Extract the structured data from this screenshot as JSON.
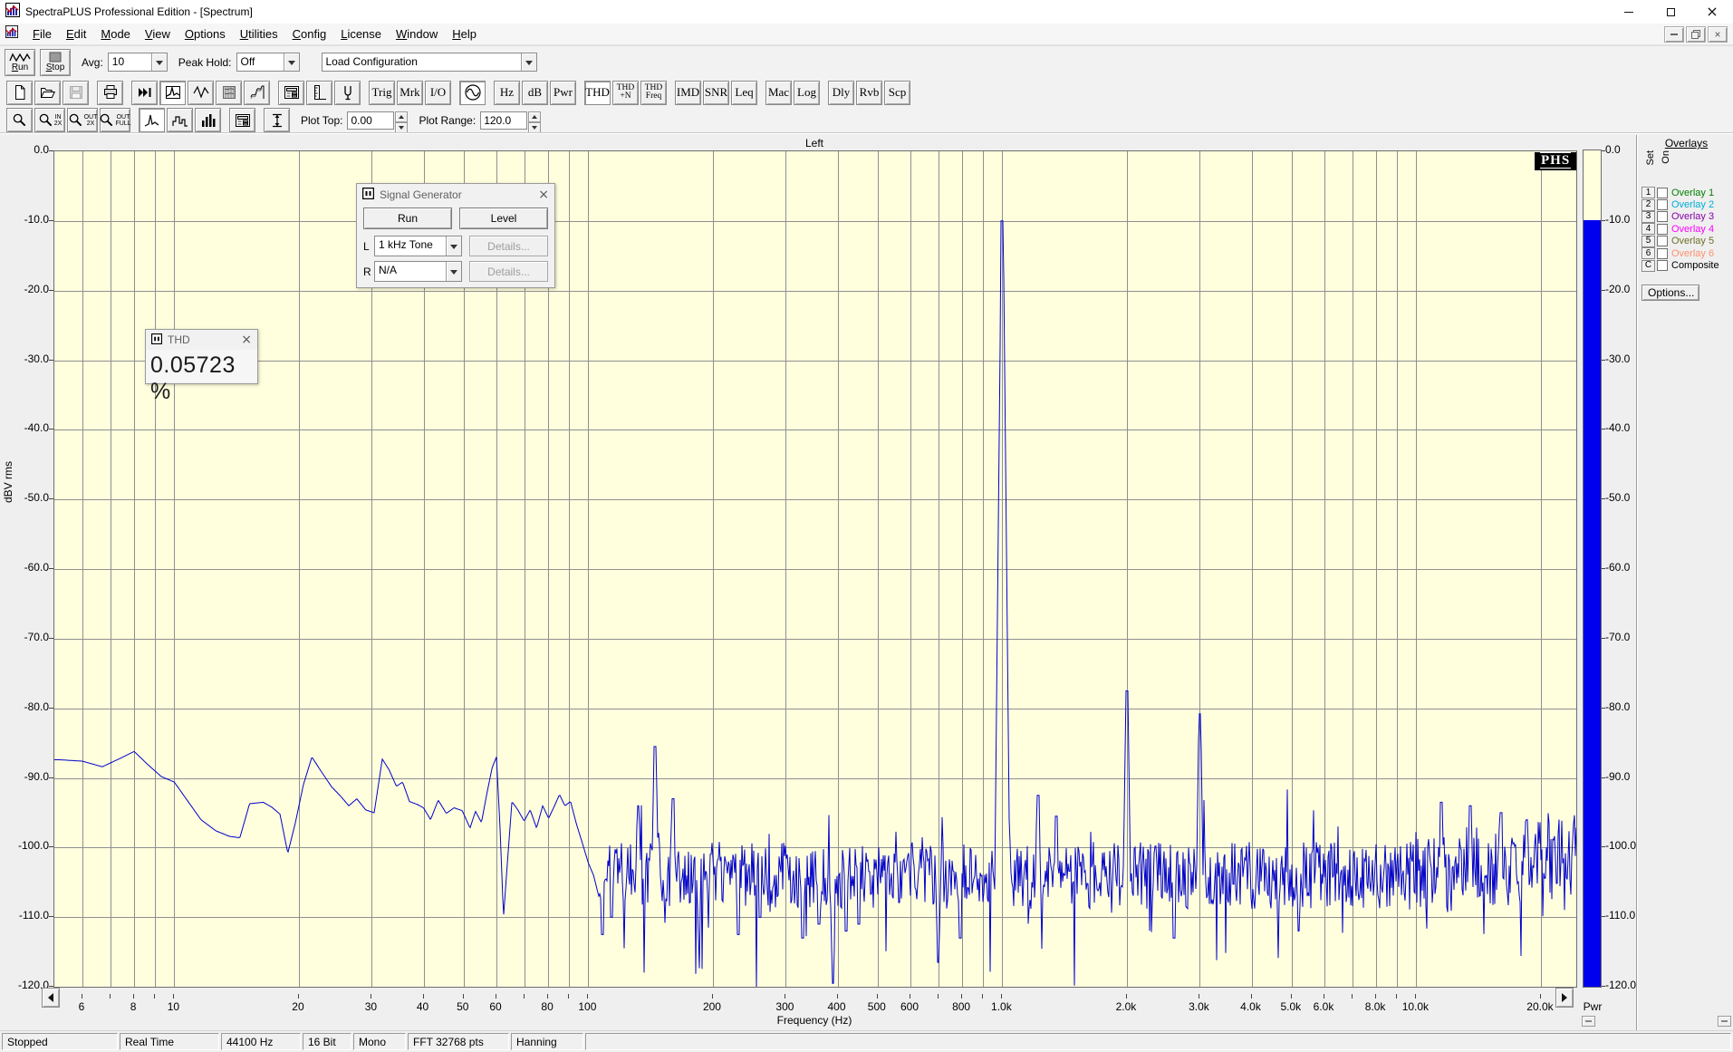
{
  "window": {
    "title": "SpectraPLUS Professional Edition - [Spectrum]"
  },
  "menu": {
    "items": [
      "File",
      "Edit",
      "Mode",
      "View",
      "Options",
      "Utilities",
      "Config",
      "License",
      "Window",
      "Help"
    ]
  },
  "transport": {
    "run_label": "Run",
    "stop_label": "Stop",
    "avg_label": "Avg:",
    "avg_value": "10",
    "peak_hold_label": "Peak Hold:",
    "peak_hold_value": "Off",
    "load_config_value": "Load Configuration"
  },
  "toolbar_main": {
    "buttons": [
      {
        "name": "new-file",
        "icon": "new-file-icon"
      },
      {
        "name": "open-file",
        "icon": "open-file-icon"
      },
      {
        "name": "save-file",
        "icon": "save-icon",
        "disabled": true
      },
      {
        "name": "print",
        "icon": "print-icon",
        "group": true
      },
      {
        "name": "restart-averaging",
        "icon": "fast-forward-icon",
        "group": true
      },
      {
        "name": "spectrum-view",
        "icon": "spectrum-view-icon",
        "pressed": true
      },
      {
        "name": "time-series-view",
        "icon": "waveform-view-icon"
      },
      {
        "name": "spectrogram-view",
        "icon": "spectrogram-view-icon"
      },
      {
        "name": "surface-view",
        "icon": "surface-view-icon"
      },
      {
        "name": "display-settings",
        "icon": "display-settings-icon",
        "group": true
      },
      {
        "name": "scaling",
        "icon": "scale-ruler-icon"
      },
      {
        "name": "calibration",
        "icon": "calibration-icon"
      },
      {
        "name": "triggering",
        "label": "Trig",
        "group": true
      },
      {
        "name": "markers",
        "label": "Mrk"
      },
      {
        "name": "io-device",
        "label": "I/O"
      },
      {
        "name": "signal-generator",
        "icon": "signal-generator-icon",
        "pressed": true,
        "group": true
      },
      {
        "name": "frequency-units",
        "label": "Hz",
        "group": true
      },
      {
        "name": "amplitude-units",
        "label": "dB"
      },
      {
        "name": "power-units",
        "label": "Pwr"
      },
      {
        "name": "thd",
        "label": "THD",
        "pressed": true,
        "group": true
      },
      {
        "name": "thd-plus-n",
        "label": "THD\n+N"
      },
      {
        "name": "thd-freq",
        "label": "THD\nFreq"
      },
      {
        "name": "imd",
        "label": "IMD",
        "group": true
      },
      {
        "name": "snr",
        "label": "SNR"
      },
      {
        "name": "leq",
        "label": "Leq"
      },
      {
        "name": "macros",
        "label": "Mac",
        "group": true
      },
      {
        "name": "logging",
        "label": "Log"
      },
      {
        "name": "delay-finder",
        "label": "Dly",
        "group": true
      },
      {
        "name": "reverb",
        "label": "Rvb"
      },
      {
        "name": "scope",
        "label": "Scp"
      }
    ]
  },
  "toolbar_zoom": {
    "buttons": [
      {
        "name": "zoom",
        "icon": "zoom-icon"
      },
      {
        "name": "zoom-in-2x",
        "icon": "zoom-icon",
        "text": "IN\n2X"
      },
      {
        "name": "zoom-out-2x",
        "icon": "zoom-icon",
        "text": "OUT\n2X"
      },
      {
        "name": "zoom-out-full",
        "icon": "zoom-icon",
        "text": "OUT\nFULL"
      },
      {
        "name": "line-plot",
        "icon": "line-plot-icon",
        "pressed": true,
        "group": true
      },
      {
        "name": "step-plot",
        "icon": "step-plot-icon"
      },
      {
        "name": "bar-plot",
        "icon": "bar-plot-icon"
      },
      {
        "name": "display-options",
        "icon": "display-settings-icon",
        "group": true
      },
      {
        "name": "amplitude-scale",
        "icon": "amplitude-scale-icon",
        "group": true
      }
    ]
  },
  "plot_controls": {
    "plot_top_label": "Plot Top:",
    "plot_top_value": "0.00",
    "plot_range_label": "Plot Range:",
    "plot_range_value": "120.0"
  },
  "plot": {
    "channel_title": "Left",
    "ylabel": "dBV rms",
    "xlabel": "Frequency (Hz)",
    "logo": "PHS",
    "pwr_label": "Pwr"
  },
  "signal_generator": {
    "title": "Signal Generator",
    "run_label": "Run",
    "level_label": "Level",
    "l_label": "L",
    "l_value": "1 kHz Tone",
    "r_label": "R",
    "r_value": "N/A",
    "details_label": "Details..."
  },
  "thd_window": {
    "title": "THD",
    "value": "0.05723 %"
  },
  "overlays": {
    "header": "Overlays",
    "set_label": "Set",
    "on_label": "On",
    "options_label": "Options...",
    "rows": [
      {
        "btn": "1",
        "label": "Overlay 1",
        "color": "#008000"
      },
      {
        "btn": "2",
        "label": "Overlay 2",
        "color": "#00aed6"
      },
      {
        "btn": "3",
        "label": "Overlay 3",
        "color": "#8800aa"
      },
      {
        "btn": "4",
        "label": "Overlay 4",
        "color": "#ff00ff"
      },
      {
        "btn": "5",
        "label": "Overlay 5",
        "color": "#6e6e28"
      },
      {
        "btn": "6",
        "label": "Overlay 6",
        "color": "#ff9070"
      },
      {
        "btn": "C",
        "label": "Composite",
        "color": "#000000"
      }
    ]
  },
  "status_bar": [
    "Stopped",
    "Real Time",
    "44100 Hz",
    "16 Bit",
    "Mono",
    "FFT 32768 pts",
    "Hanning",
    ""
  ],
  "chart_data": {
    "type": "line",
    "title": "Left",
    "xlabel": "Frequency (Hz)",
    "ylabel": "dBV rms",
    "x_scale": "log",
    "xlim": [
      5.3,
      24300
    ],
    "ylim": [
      -120,
      0
    ],
    "grid": true,
    "trace_color": "#0000cc",
    "plot_bg": "#ffffde",
    "grid_color": "#8f8f8f",
    "y_ticks": [
      0,
      -10,
      -20,
      -30,
      -40,
      -50,
      -60,
      -70,
      -80,
      -90,
      -100,
      -110,
      -120
    ],
    "y_tick_labels": [
      "0.0",
      "-10.0",
      "-20.0",
      "-30.0",
      "-40.0",
      "-50.0",
      "-60.0",
      "-70.0",
      "-80.0",
      "-90.0",
      "-100.0",
      "-110.0",
      "-120.0"
    ],
    "x_tick_values": [
      6,
      8,
      10,
      20,
      30,
      40,
      50,
      60,
      80,
      100,
      200,
      300,
      400,
      500,
      600,
      800,
      1000,
      2000,
      3000,
      4000,
      5000,
      6000,
      8000,
      10000,
      20000
    ],
    "x_tick_labels": [
      "6",
      "8",
      "10",
      "20",
      "30",
      "40",
      "50",
      "60",
      "80",
      "100",
      "200",
      "300",
      "400",
      "500",
      "600",
      "800",
      "1.0k",
      "2.0k",
      "3.0k",
      "4.0k",
      "5.0k",
      "6.0k",
      "8.0k",
      "10.0k",
      "20.0k"
    ],
    "envelope_db_by_hz": [
      [
        5.3,
        -87.4
      ],
      [
        6.0,
        -87.6
      ],
      [
        6.7,
        -88.4
      ],
      [
        7.4,
        -87.2
      ],
      [
        8.0,
        -86.2
      ],
      [
        8.6,
        -88.0
      ],
      [
        9.3,
        -89.8
      ],
      [
        10.0,
        -90.6
      ],
      [
        10.8,
        -93.4
      ],
      [
        11.6,
        -96.0
      ],
      [
        12.6,
        -97.6
      ],
      [
        13.6,
        -98.4
      ],
      [
        14.4,
        -98.6
      ],
      [
        15.2,
        -93.7
      ],
      [
        16.4,
        -93.5
      ],
      [
        17.2,
        -94.2
      ],
      [
        18.0,
        -95.2
      ],
      [
        18.8,
        -100.8
      ],
      [
        19.6,
        -96.5
      ],
      [
        20.5,
        -91.0
      ],
      [
        21.5,
        -87.0
      ],
      [
        22.6,
        -89.0
      ],
      [
        24.0,
        -91.3
      ],
      [
        25.2,
        -92.6
      ],
      [
        26.4,
        -94.0
      ],
      [
        27.6,
        -93.0
      ],
      [
        29.0,
        -94.6
      ],
      [
        30.4,
        -95.0
      ],
      [
        31.8,
        -87.3
      ],
      [
        33.0,
        -88.8
      ],
      [
        34.4,
        -91.2
      ],
      [
        35.6,
        -90.6
      ],
      [
        37.0,
        -93.4
      ],
      [
        38.6,
        -93.8
      ],
      [
        40.0,
        -94.3
      ],
      [
        41.6,
        -96.0
      ],
      [
        43.4,
        -93.2
      ],
      [
        45.4,
        -95.1
      ],
      [
        47.4,
        -94.3
      ],
      [
        49.6,
        -94.7
      ],
      [
        51.8,
        -97.2
      ],
      [
        53.4,
        -94.8
      ],
      [
        55.2,
        -96.4
      ],
      [
        57.0,
        -92.0
      ],
      [
        58.6,
        -88.5
      ],
      [
        60.0,
        -87.0
      ],
      [
        61.2,
        -97.0
      ],
      [
        62.4,
        -110.0
      ],
      [
        63.8,
        -102.0
      ],
      [
        65.4,
        -93.4
      ],
      [
        67.6,
        -94.6
      ],
      [
        70.0,
        -96.2
      ],
      [
        72.4,
        -94.6
      ],
      [
        75.0,
        -97.2
      ],
      [
        77.6,
        -94.0
      ],
      [
        80.2,
        -95.8
      ],
      [
        82.6,
        -94.2
      ],
      [
        85.2,
        -92.4
      ],
      [
        87.8,
        -94.0
      ],
      [
        90.6,
        -93.4
      ],
      [
        93.6,
        -96.6
      ],
      [
        96.8,
        -99.4
      ],
      [
        100.0,
        -102.2
      ],
      [
        103.0,
        -104.0
      ],
      [
        106.0,
        -107.0
      ],
      [
        110.0,
        -104.5
      ]
    ],
    "spikes": [
      [
        132,
        -94,
        6
      ],
      [
        145,
        -85.5,
        7
      ],
      [
        160,
        -93,
        6
      ],
      [
        1000,
        -10,
        13
      ],
      [
        1220,
        -92.5,
        7
      ],
      [
        1350,
        -95.5,
        7
      ],
      [
        2000,
        -77.5,
        9
      ],
      [
        3000,
        -80.8,
        9
      ],
      [
        11500,
        -93.5,
        7
      ],
      [
        13500,
        -94,
        7
      ],
      [
        16000,
        -95,
        7
      ],
      [
        18500,
        -96,
        7
      ]
    ],
    "dips": [
      [
        108,
        -112.5,
        8
      ],
      [
        114,
        -110,
        8
      ],
      [
        122,
        -107.5,
        8
      ],
      [
        185,
        -113,
        9
      ],
      [
        230,
        -112.5,
        9
      ],
      [
        260,
        -110,
        9
      ],
      [
        330,
        -113,
        9
      ],
      [
        360,
        -111,
        9
      ],
      [
        390,
        -119.5,
        10
      ],
      [
        420,
        -112,
        9
      ],
      [
        450,
        -111,
        9
      ],
      [
        700,
        -116.5,
        10
      ],
      [
        790,
        -113,
        9
      ],
      [
        2600,
        -113,
        9
      ],
      [
        5200,
        -112,
        9
      ]
    ],
    "noise": {
      "start_hz": 110,
      "base_db": -104,
      "base_db_hf": -101.5,
      "hf_start_hz": 9000,
      "amp_db": 4.8,
      "amp_db_hf": 6.0,
      "down_spike_prob": 0.028,
      "up_spike_prob": 0.02,
      "seed": 20131
    },
    "power_bar": {
      "top_db": -10,
      "color": "#0000ee"
    }
  }
}
